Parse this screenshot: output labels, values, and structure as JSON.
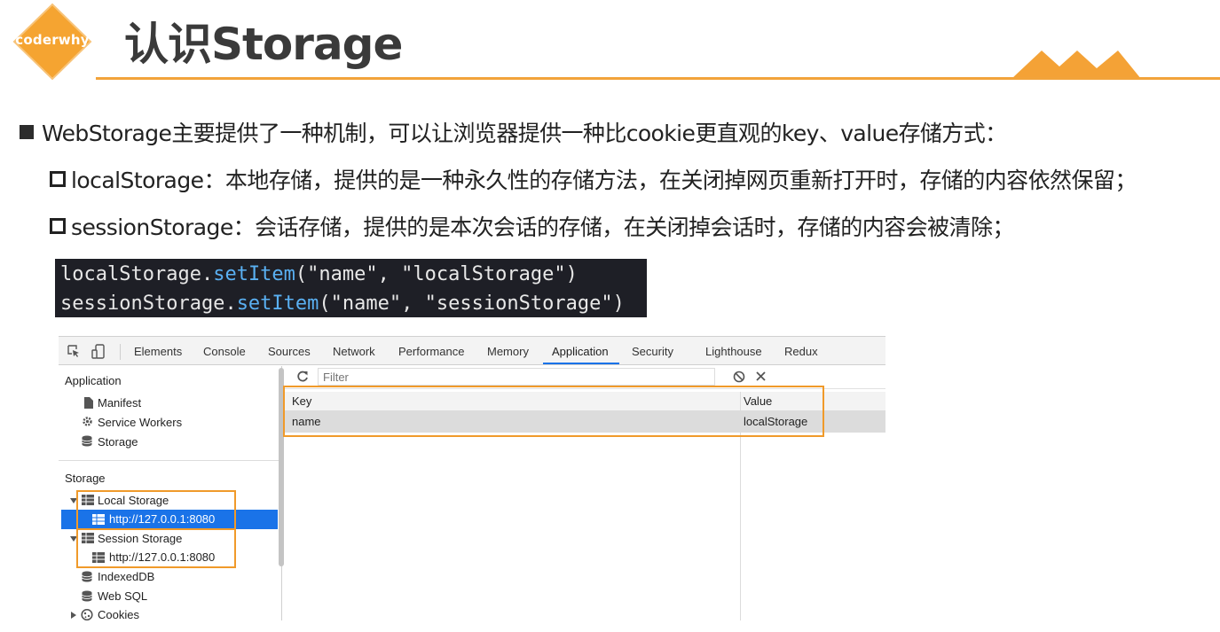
{
  "logo": {
    "text": "coderwhy"
  },
  "title": "认识Storage",
  "colors": {
    "accent": "#f2a33a",
    "logo": "#f5a431",
    "selection": "#1a73e8",
    "highlight": "#f09a2a"
  },
  "bullets": [
    "WebStorage主要提供了一种机制，可以让浏览器提供一种比cookie更直观的key、value存储方式：",
    "localStorage：本地存储，提供的是一种永久性的存储方法，在关闭掉网页重新打开时，存储的内容依然保留；",
    "sessionStorage：会话存储，提供的是本次会话的存储，在关闭掉会话时，存储的内容会被清除；"
  ],
  "code": {
    "line1": {
      "object": "localStorage",
      "dot": ".",
      "method": "setItem",
      "open": "(",
      "arg1": "\"name\"",
      "comma": ", ",
      "arg2": "\"localStorage\"",
      "close": ")"
    },
    "line2": {
      "object": "sessionStorage",
      "dot": ".",
      "method": "setItem",
      "open": "(",
      "arg1": "\"name\"",
      "comma": ", ",
      "arg2": "\"sessionStorage\"",
      "close": ")"
    }
  },
  "devtools": {
    "tabs": [
      "Elements",
      "Console",
      "Sources",
      "Network",
      "Performance",
      "Memory",
      "Application",
      "Security",
      "Lighthouse",
      "Redux"
    ],
    "active_tab": "Application",
    "sidebar": {
      "application_header": "Application",
      "application_items": [
        "Manifest",
        "Service Workers",
        "Storage"
      ],
      "storage_header": "Storage",
      "local_storage": "Local Storage",
      "local_storage_origin": "http://127.0.0.1:8080",
      "session_storage": "Session Storage",
      "session_storage_origin": "http://127.0.0.1:8080",
      "other_items": [
        "IndexedDB",
        "Web SQL",
        "Cookies"
      ]
    },
    "filter_placeholder": "Filter",
    "grid": {
      "headers": [
        "Key",
        "Value"
      ],
      "rows": [
        [
          "name",
          "localStorage"
        ]
      ]
    },
    "icons": [
      "inspect-icon",
      "device-toggle-icon",
      "refresh-icon",
      "clear-all-icon",
      "delete-icon",
      "document-icon",
      "gear-icon",
      "database-icon",
      "table-icon",
      "cookie-icon"
    ]
  }
}
